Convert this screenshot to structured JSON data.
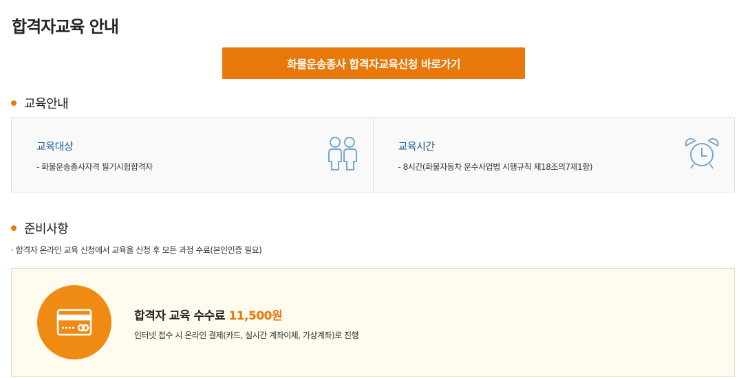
{
  "page": {
    "title": "합격자교육 안내"
  },
  "apply_button": {
    "label": "화물운송종사 합격자교육신청 바로가기"
  },
  "education_section": {
    "heading": "교육안내",
    "cells": [
      {
        "title": "교육대상",
        "desc": "- 화물운송종사자격 필기시험합격자",
        "icon": "people-icon"
      },
      {
        "title": "교육시간",
        "desc": "- 8시간(화물자동차 운수사업법 시행규칙 제18조의7제1항)",
        "icon": "alarm-clock-icon"
      }
    ]
  },
  "prep_section": {
    "heading": "준비사항",
    "note": "· 합격자 온라인 교육 신청에서 교육을 신청 후 모든 과정 수료(본인인증 필요)"
  },
  "fee": {
    "title": "합격자 교육 수수료",
    "amount": "11,500원",
    "desc": "인터넷 접수 시 온라인 결제(카드, 실시간 계좌이체, 가상계좌)로 진행",
    "icon": "credit-card-icon"
  },
  "colors": {
    "accent": "#e8780a",
    "link_blue": "#1a5c9e",
    "icon_blue": "#6fa8d6",
    "fee_bg": "#fffbef"
  }
}
